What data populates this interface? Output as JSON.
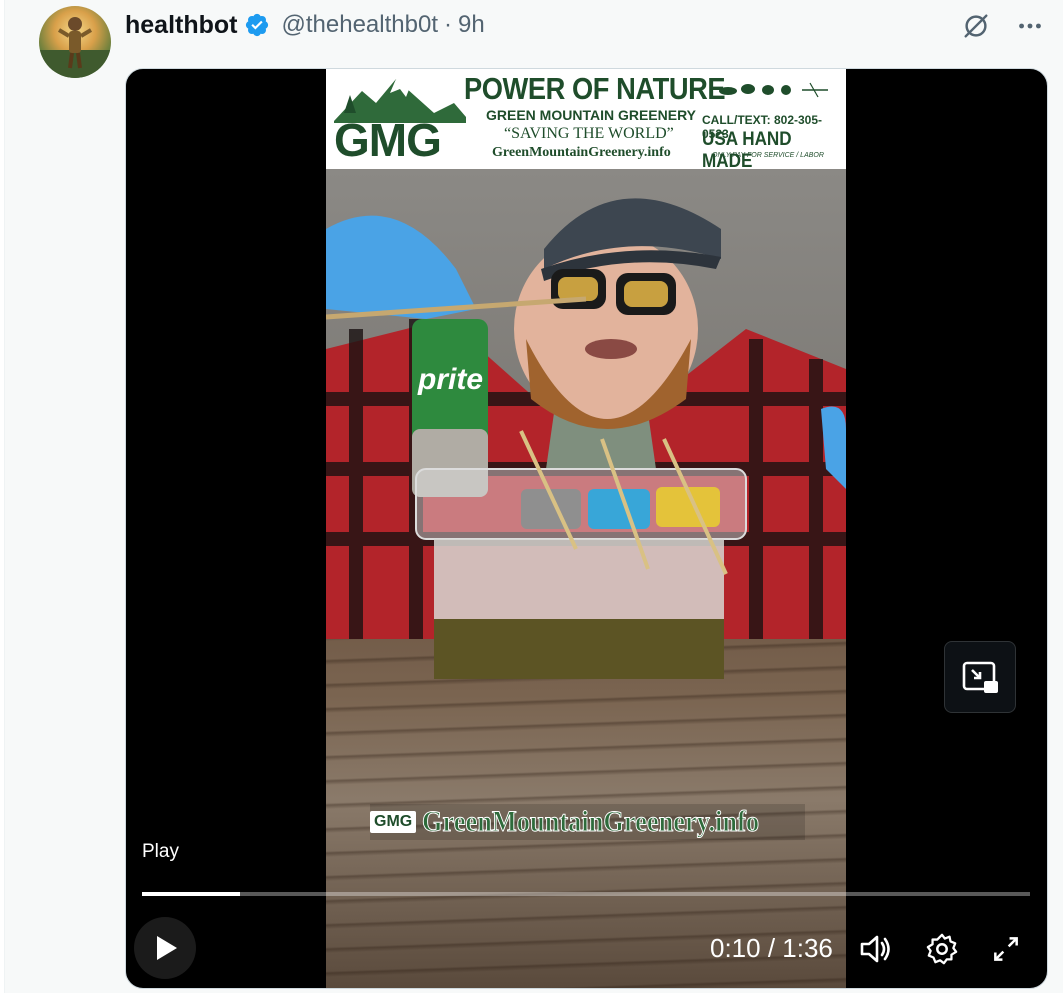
{
  "post": {
    "display_name": "healthbot",
    "handle": "@thehealthb0t",
    "separator": "·",
    "time": "9h",
    "verified": true
  },
  "header_icons": [
    "grok-icon",
    "more-icon"
  ],
  "video": {
    "banner": {
      "title": "POWER OF NATURE",
      "logo_letters": "GMG",
      "company": "GREEN MOUNTAIN GREENERY",
      "slogan": "“SAVING THE WORLD”",
      "url": "GreenMountainGreenery.info",
      "call": "CALL/TEXT: 802-305-0523",
      "made": "USA HAND MADE",
      "pay": "ONLY PAY FOR SERVICE / LABOR"
    },
    "can_label": "prite",
    "watermark_logo": "GMG",
    "watermark_text": "GreenMountainGreenery.info",
    "tooltip": "Play",
    "time_readout": "0:10 / 1:36",
    "progress_fraction": 0.11
  },
  "colors": {
    "verified_blue": "#1d9bf0",
    "brand_green": "#1f4d2b"
  }
}
